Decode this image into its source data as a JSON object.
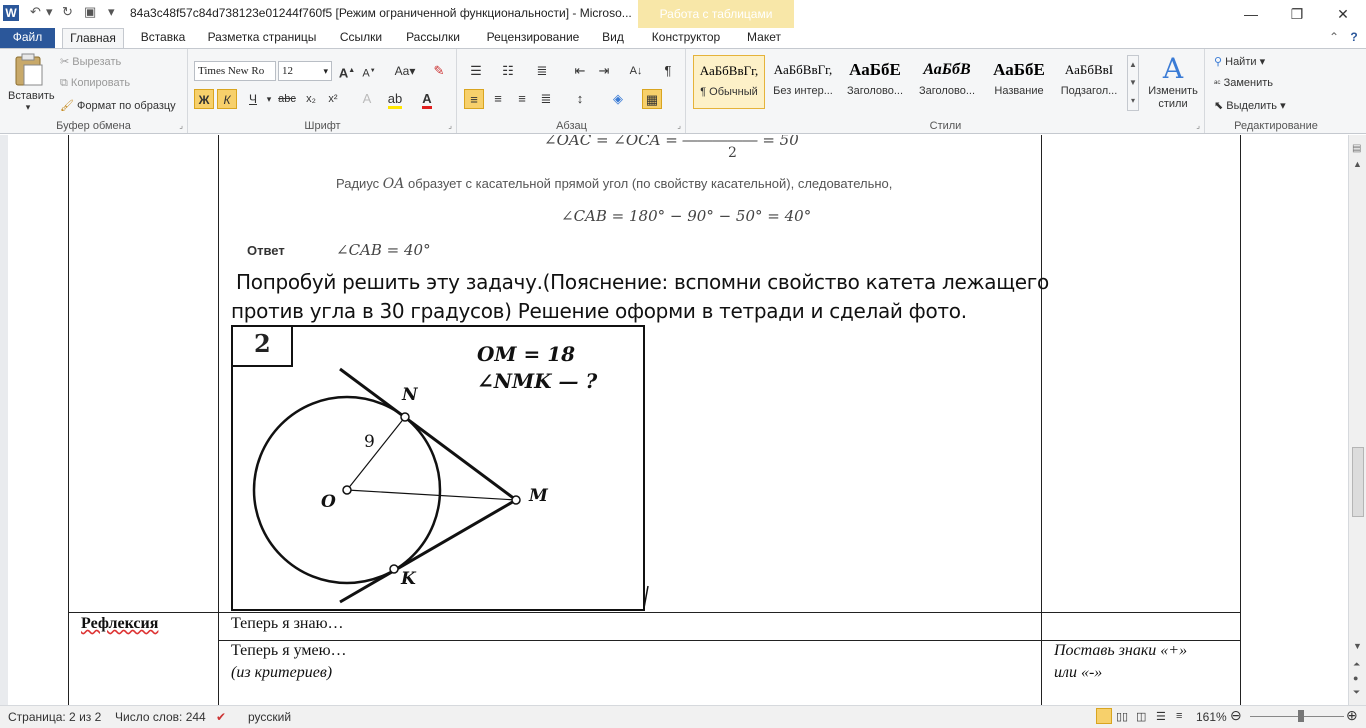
{
  "titlebar": {
    "title": "84a3c48f57c84d738123e01244f760f5 [Режим ограниченной функциональности]  -  Microso...",
    "context_tab": "Работа с таблицами"
  },
  "tabs": [
    "Файл",
    "Главная",
    "Вставка",
    "Разметка страницы",
    "Ссылки",
    "Рассылки",
    "Рецензирование",
    "Вид",
    "Конструктор",
    "Макет"
  ],
  "ribbon": {
    "clipboard": {
      "paste": "Вставить",
      "cut": "Вырезать",
      "copy": "Копировать",
      "format_painter": "Формат по образцу",
      "label": "Буфер обмена"
    },
    "font": {
      "name": "Times New Ro",
      "size": "12",
      "label": "Шрифт"
    },
    "paragraph": {
      "label": "Абзац"
    },
    "styles": {
      "items": [
        {
          "sample": "АаБбВвГг,",
          "name": "¶ Обычный"
        },
        {
          "sample": "АаБбВвГг,",
          "name": "Без интер..."
        },
        {
          "sample": "АаБбЕ",
          "name": "Заголово..."
        },
        {
          "sample": "АаБбВ",
          "name": "Заголово..."
        },
        {
          "sample": "АаБбЕ",
          "name": "Название"
        },
        {
          "sample": "АаБбВвІ",
          "name": "Подзагол..."
        }
      ],
      "change_styles": "Изменить стили",
      "label": "Стили"
    },
    "editing": {
      "find": "Найти",
      "replace": "Заменить",
      "select": "Выделить",
      "label": "Редактирование"
    }
  },
  "document": {
    "formula_top": "∠OAC = ∠OCA = ――――― = 50",
    "formula_top_denominator": "2",
    "radius_text": "Радиус",
    "radius_var": "OA",
    "radius_rest": "образует с касательной прямой угол (по свойству касательной), следовательно,",
    "formula_cab": "∠CAB = 180° − 90° − 50° = 40°",
    "answer_label": "Ответ",
    "answer_value": "∠CAB = 40°",
    "task_line1": " Попробуй решить эту задачу.(Пояснение: вспомни свойство катета лежащего",
    "task_line2": "против угла в 30 градусов) Решение оформи в тетради и сделай фото.",
    "figure": {
      "number": "2",
      "given1": "OM = 18",
      "given2": "∠NMK — ?",
      "radius_label": "9",
      "point_n": "N",
      "point_o": "O",
      "point_m": "M",
      "point_k": "K"
    },
    "reflection_label": "Рефлексия",
    "row1_text": "Теперь я знаю…",
    "row2_text": "Теперь я умею…",
    "row2_sub": "(из критериев)",
    "row2_right_line1": "Поставь знаки «+»",
    "row2_right_line2": "или «-»"
  },
  "status": {
    "page": "Страница: 2 из 2",
    "words": "Число слов: 244",
    "lang": "русский",
    "zoom": "161%"
  }
}
